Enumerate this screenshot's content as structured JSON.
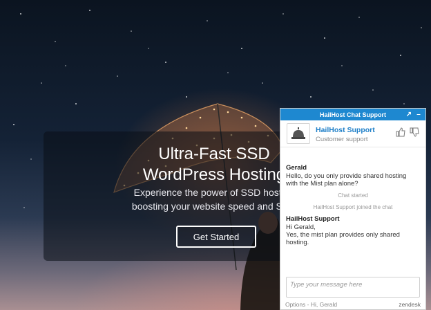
{
  "hero": {
    "title": "Ultra-Fast SSD\nWordPress Hosting",
    "subtitle": "Experience the power of SSD hosting\nboosting your website speed and SEO",
    "cta_label": "Get Started"
  },
  "chat": {
    "header_title": "HailHost Chat Support",
    "expand_symbol": "↗",
    "minimize_symbol": "–",
    "agent_name": "HailHost Support",
    "agent_role": "Customer support",
    "messages": [
      {
        "sender": "Gerald",
        "text": "Hello, do you only provide shared hosting\nwith the Mist plan alone?"
      },
      {
        "system": "Chat started"
      },
      {
        "system": "HailHost Support joined the chat"
      },
      {
        "sender": "HailHost Support",
        "text": "Hi Gerald,\nYes, the mist plan provides only shared\nhosting."
      }
    ],
    "input_placeholder": "Type your message here",
    "footer_left": "Options - Hi, Gerald",
    "footer_right": "zendesk",
    "icons": [
      "bell-icon",
      "thumbs-up-icon",
      "thumbs-down-icon",
      "expand-icon",
      "minimize-icon"
    ]
  },
  "colors": {
    "chat_header": "#1e88d0",
    "agent_name": "#1e7fc8"
  }
}
